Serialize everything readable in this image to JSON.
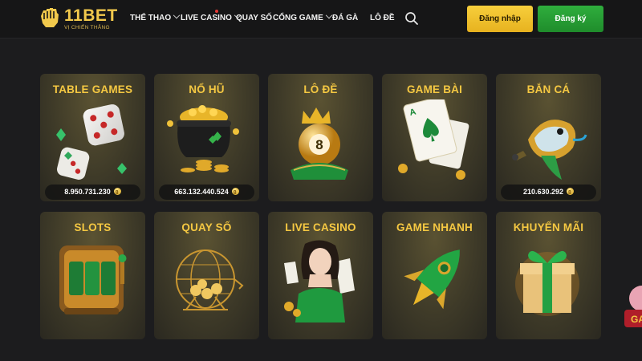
{
  "brand": {
    "name": "11BET",
    "tagline": "VỊ CHIẾN THẮNG"
  },
  "nav": {
    "items": [
      {
        "label": "THỂ THAO",
        "has_dropdown": true
      },
      {
        "label": "LIVE CASINO",
        "has_dropdown": true,
        "has_dot": true
      },
      {
        "label": "QUAY SỐ",
        "has_dropdown": false
      },
      {
        "label": "CỔNG GAME",
        "has_dropdown": true
      },
      {
        "label": "ĐÁ GÀ",
        "has_dropdown": false
      },
      {
        "label": "LÔ ĐỀ",
        "has_dropdown": false
      }
    ],
    "search_icon": "search-icon"
  },
  "auth": {
    "login_label": "Đăng nhập",
    "register_label": "Đăng ký"
  },
  "colors": {
    "accent_gold": "#f5c842",
    "login_bg": "#f2c232",
    "register_bg": "#27a034",
    "page_bg": "#1c1c1e"
  },
  "games": [
    {
      "title": "TABLE GAMES",
      "jackpot": "8.950.731.230",
      "icon": "dice-icon"
    },
    {
      "title": "NỔ HŨ",
      "jackpot": "663.132.440.524",
      "icon": "gold-pot-icon"
    },
    {
      "title": "LÔ ĐỀ",
      "icon": "lottery-ball-icon"
    },
    {
      "title": "GAME BÀI",
      "icon": "playing-cards-icon"
    },
    {
      "title": "BẮN CÁ",
      "jackpot": "210.630.292",
      "icon": "fish-icon"
    },
    {
      "title": "SLOTS",
      "icon": "slot-machine-icon"
    },
    {
      "title": "QUAY SỐ",
      "icon": "lottery-cage-icon"
    },
    {
      "title": "LIVE CASINO",
      "icon": "live-dealer-icon"
    },
    {
      "title": "GAME NHANH",
      "icon": "rocket-icon"
    },
    {
      "title": "KHUYẾN MÃI",
      "icon": "gift-box-icon"
    }
  ]
}
